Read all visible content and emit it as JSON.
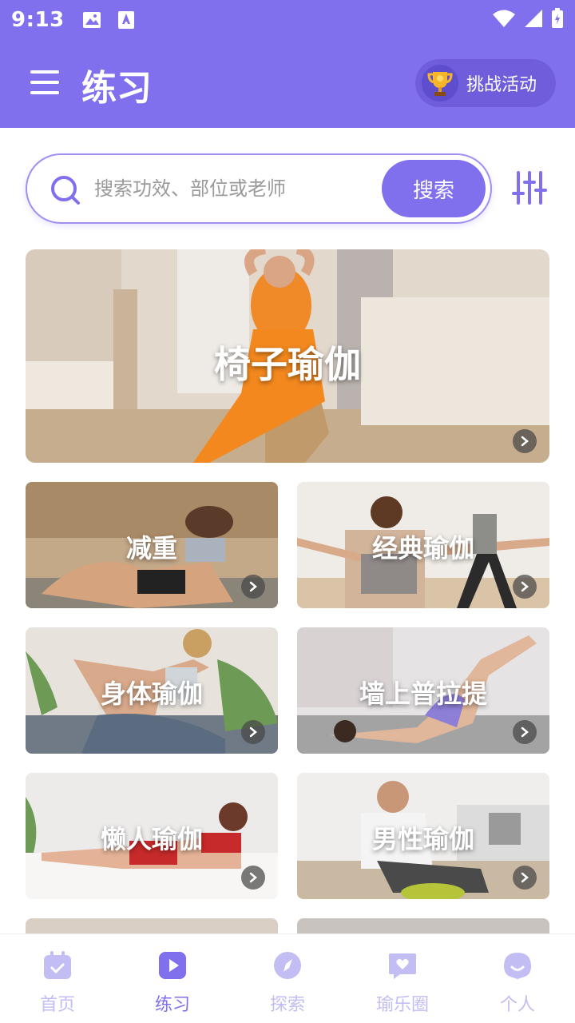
{
  "status_bar": {
    "time": "9:13"
  },
  "header": {
    "title": "练习",
    "challenge_label": "挑战活动"
  },
  "search": {
    "placeholder": "搜索功效、部位或老师",
    "button_label": "搜索"
  },
  "featured": {
    "title": "椅子瑜伽"
  },
  "categories": [
    {
      "title": "减重"
    },
    {
      "title": "经典瑜伽"
    },
    {
      "title": "身体瑜伽"
    },
    {
      "title": "墙上普拉提"
    },
    {
      "title": "懒人瑜伽"
    },
    {
      "title": "男性瑜伽"
    }
  ],
  "tabs": [
    {
      "label": "首页",
      "icon": "calendar-icon",
      "active": false
    },
    {
      "label": "练习",
      "icon": "play-icon",
      "active": true
    },
    {
      "label": "探索",
      "icon": "compass-icon",
      "active": false
    },
    {
      "label": "瑜乐圈",
      "icon": "heart-chat-icon",
      "active": false
    },
    {
      "label": "个人",
      "icon": "profile-icon",
      "active": false
    }
  ],
  "colors": {
    "primary": "#8170ee",
    "tab_inactive": "#c2bdf3"
  }
}
